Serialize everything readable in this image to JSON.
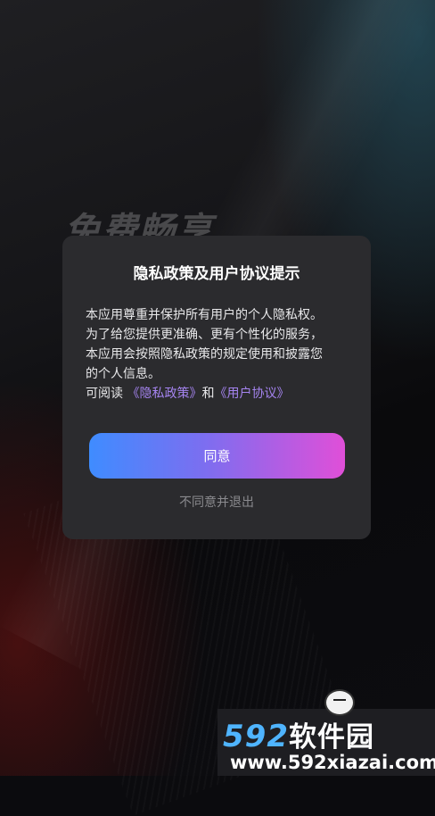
{
  "background": {
    "slogan": "免费畅享"
  },
  "dialog": {
    "title": "隐私政策及用户协议提示",
    "body_line1": "本应用尊重并保护所有用户的个人隐私权。",
    "body_line2": "为了给您提供更准确、更有个性化的服务，",
    "body_line3": "本应用会按照隐私政策的规定使用和披露您",
    "body_line4": "的个人信息。",
    "read_prefix": "可阅读 ",
    "privacy_link": "《隐私政策》",
    "conjunction": "和",
    "agreement_link": "《用户协议》",
    "agree_label": "同意",
    "disagree_label": "不同意并退出"
  },
  "watermark": {
    "number": "592",
    "brand_cn": "软件园",
    "url": "www.592xiazai.com"
  },
  "colors": {
    "dialog_bg": "#2b2b2e",
    "link": "#a584f0",
    "button_gradient_start": "#3f8cff",
    "button_gradient_end": "#e04fd8",
    "muted_text": "#8a8a8e"
  },
  "icons": {
    "watermark_mascot": "mascot-icon"
  }
}
